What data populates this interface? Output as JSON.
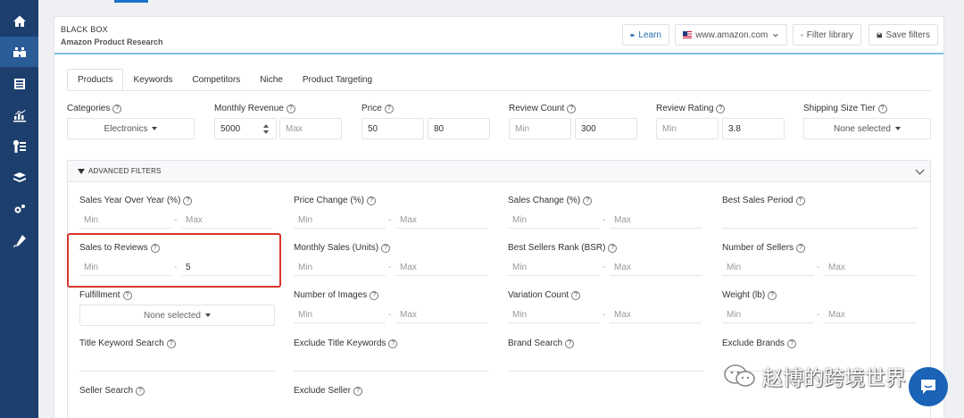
{
  "sidebar": {
    "items": [
      {
        "icon": "home-icon"
      },
      {
        "icon": "binoculars-icon",
        "active": true
      },
      {
        "icon": "list-icon"
      },
      {
        "icon": "chart-icon"
      },
      {
        "icon": "keyword-icon"
      },
      {
        "icon": "stack-icon"
      },
      {
        "icon": "gear-icon"
      },
      {
        "icon": "tools-icon"
      }
    ]
  },
  "header": {
    "brand_line1": "BLACK BOX",
    "brand_line2": "Amazon Product Research",
    "learn_label": "Learn",
    "marketplace_label": "www.amazon.com",
    "filter_library_label": "Filter library",
    "save_filters_label": "Save filters"
  },
  "tabs": [
    {
      "label": "Products",
      "active": true
    },
    {
      "label": "Keywords"
    },
    {
      "label": "Competitors"
    },
    {
      "label": "Niche"
    },
    {
      "label": "Product Targeting"
    }
  ],
  "filters": {
    "categories": {
      "label": "Categories",
      "value": "Electronics"
    },
    "monthly_revenue": {
      "label": "Monthly Revenue",
      "min": "5000",
      "max_placeholder": "Max"
    },
    "price": {
      "label": "Price",
      "min": "50",
      "max": "80"
    },
    "review_count": {
      "label": "Review Count",
      "min_placeholder": "Min",
      "max": "300"
    },
    "review_rating": {
      "label": "Review Rating",
      "min_placeholder": "Min",
      "max": "3.8"
    },
    "shipping_size_tier": {
      "label": "Shipping Size Tier",
      "value": "None selected"
    }
  },
  "advanced": {
    "title": "ADVANCED FILTERS",
    "min_placeholder": "Min",
    "max_placeholder": "Max",
    "dash": "-",
    "none_selected": "None selected",
    "sales_yoy": "Sales Year Over Year (%)",
    "price_change": "Price Change (%)",
    "sales_change": "Sales Change (%)",
    "best_sales_period": "Best Sales Period",
    "sales_to_reviews": {
      "label": "Sales to Reviews",
      "max": "5"
    },
    "monthly_sales_units": "Monthly Sales (Units)",
    "bsr": "Best Sellers Rank (BSR)",
    "number_of_sellers": "Number of Sellers",
    "fulfillment": "Fulfillment",
    "number_of_images": "Number of Images",
    "variation_count": "Variation Count",
    "weight": "Weight (lb)",
    "title_keyword_search": "Title Keyword Search",
    "exclude_title_keywords": "Exclude Title Keywords",
    "brand_search": "Brand Search",
    "exclude_brands": "Exclude Brands",
    "seller_search": "Seller Search",
    "exclude_seller": "Exclude Seller"
  },
  "watermark": {
    "text": "赵博的跨境世界"
  },
  "colors": {
    "sidebar": "#1c3f6e",
    "accent": "#1a73c8",
    "highlight": "#d9342b"
  }
}
